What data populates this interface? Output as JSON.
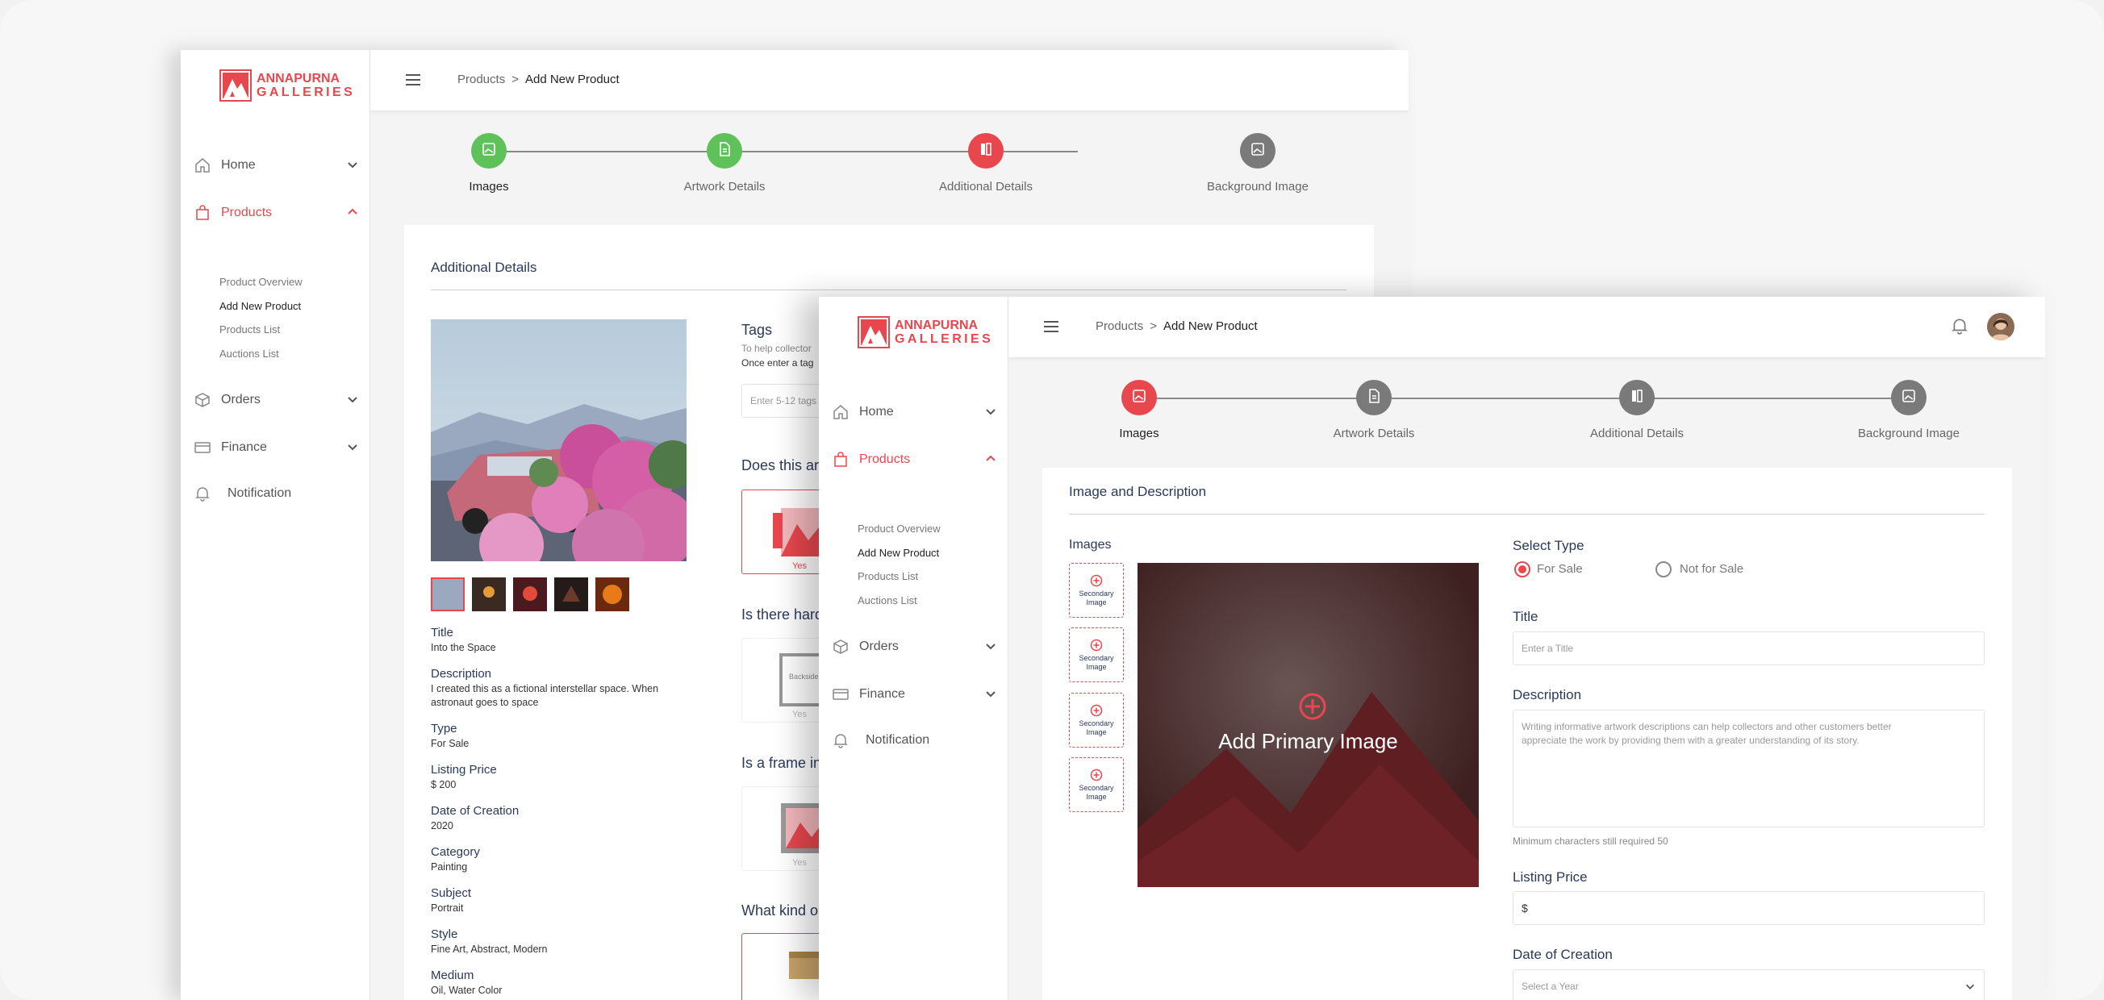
{
  "brand": {
    "line1": "ANNAPURNA",
    "line2": "GALLERIES",
    "color": "#e8474e"
  },
  "sidebar": {
    "items": [
      {
        "label": "Home",
        "icon": "home-icon"
      },
      {
        "label": "Products",
        "icon": "bag-icon"
      },
      {
        "label": "Orders",
        "icon": "box-icon"
      },
      {
        "label": "Finance",
        "icon": "card-icon"
      },
      {
        "label": "Notification",
        "icon": "bell-icon"
      }
    ],
    "sub_items": [
      "Product Overview",
      "Add New Product",
      "Products List",
      "Auctions List"
    ]
  },
  "breadcrumb": {
    "parent": "Products",
    "sep": ">",
    "current": "Add New Product"
  },
  "steps": [
    {
      "label": "Images",
      "icon": "image-icon"
    },
    {
      "label": "Artwork Details",
      "icon": "document-icon"
    },
    {
      "label": "Additional Details",
      "icon": "details-icon"
    },
    {
      "label": "Background Image",
      "icon": "image-icon"
    }
  ],
  "back_window": {
    "card_title": "Additional Details",
    "summary": [
      {
        "label": "Title",
        "value": "Into the Space"
      },
      {
        "label": "Description",
        "value": "I created this as a fictional interstellar space. When astronaut goes to space"
      },
      {
        "label": "Type",
        "value": "For Sale"
      },
      {
        "label": "Listing Price",
        "value": "$ 200"
      },
      {
        "label": "Date of Creation",
        "value": "2020"
      },
      {
        "label": "Category",
        "value": "Painting"
      },
      {
        "label": "Subject",
        "value": "Portrait"
      },
      {
        "label": "Style",
        "value": "Fine Art, Abstract, Modern"
      },
      {
        "label": "Medium",
        "value": "Oil, Water Color"
      }
    ],
    "tags": {
      "label": "Tags",
      "help1": "To help collector",
      "help2": "Once enter a tag",
      "placeholder": "Enter 5-12 tags"
    },
    "questions": [
      "Does this ar",
      "Is there hard",
      "Is a frame in",
      "What kind o"
    ],
    "yes": "Yes",
    "backside_text": "Backside"
  },
  "front_window": {
    "card_title": "Image and Description",
    "images_label": "Images",
    "secondary_label": "Secondary Image",
    "primary_label": "Add Primary Image",
    "select_type": {
      "label": "Select Type",
      "options": [
        "For Sale",
        "Not for Sale"
      ],
      "selected": "For Sale"
    },
    "title": {
      "label": "Title",
      "placeholder": "Enter a Title"
    },
    "description": {
      "label": "Description",
      "placeholder": "Writing informative artwork descriptions can help collectors and other customers better appreciate the work by providing them with a greater understanding of its story.",
      "hint": "Minimum characters still required 50"
    },
    "listing_price": {
      "label": "Listing Price",
      "prefix": "$"
    },
    "date_of_creation": {
      "label": "Date of Creation",
      "placeholder": "Select a Year"
    }
  }
}
